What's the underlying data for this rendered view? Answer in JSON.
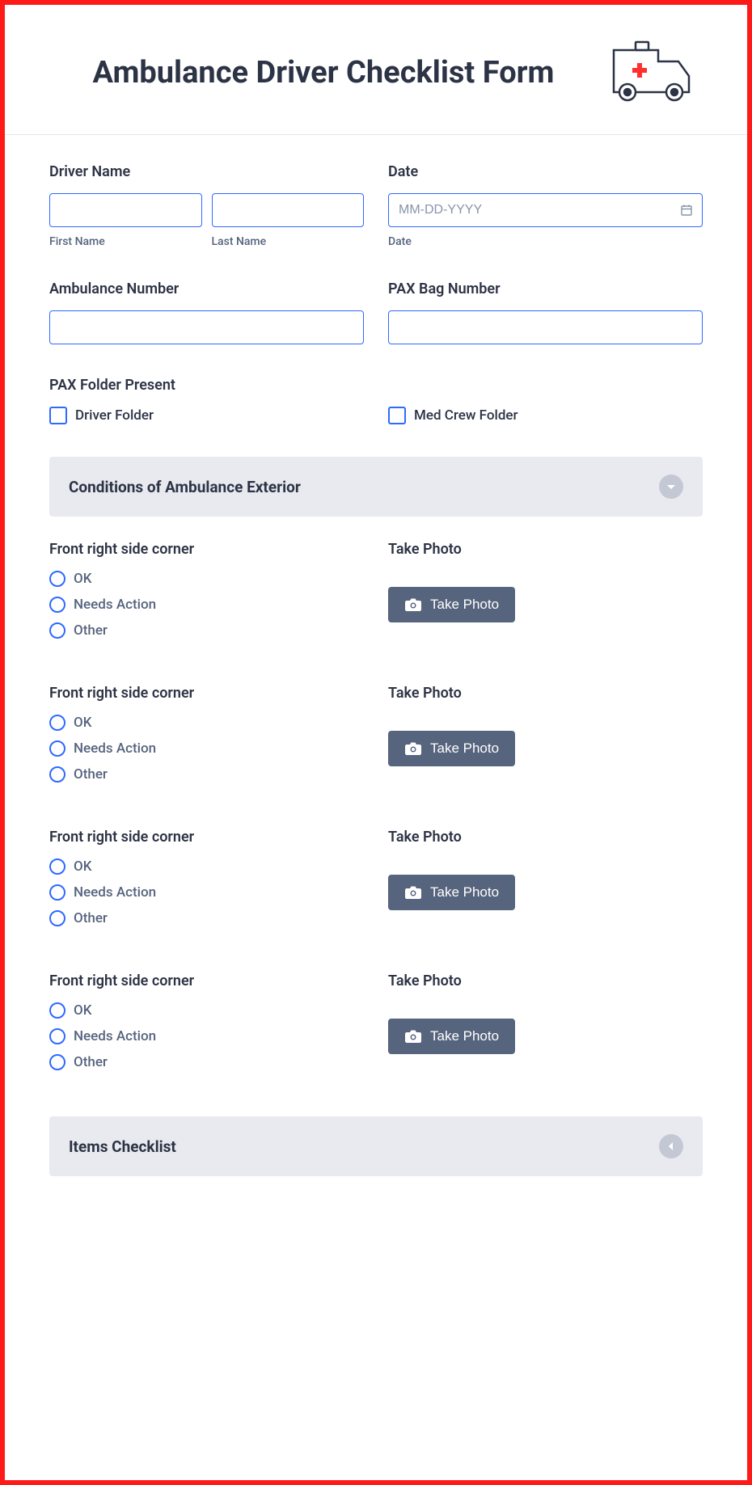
{
  "header": {
    "title": "Ambulance Driver Checklist Form"
  },
  "fields": {
    "driver_name_label": "Driver Name",
    "first_name_sublabel": "First Name",
    "last_name_sublabel": "Last Name",
    "date_label": "Date",
    "date_placeholder": "MM-DD-YYYY",
    "date_sublabel": "Date",
    "ambulance_number_label": "Ambulance Number",
    "pax_bag_label": "PAX Bag Number",
    "pax_folder_label": "PAX Folder Present",
    "driver_folder_check": "Driver Folder",
    "med_crew_check": "Med Crew Folder"
  },
  "sections": {
    "exterior_title": "Conditions of Ambulance Exterior",
    "items_title": "Items Checklist"
  },
  "condition": {
    "question": "Front right side corner",
    "opt_ok": "OK",
    "opt_needs": "Needs Action",
    "opt_other": "Other",
    "photo_label": "Take Photo",
    "photo_btn": "Take Photo"
  }
}
